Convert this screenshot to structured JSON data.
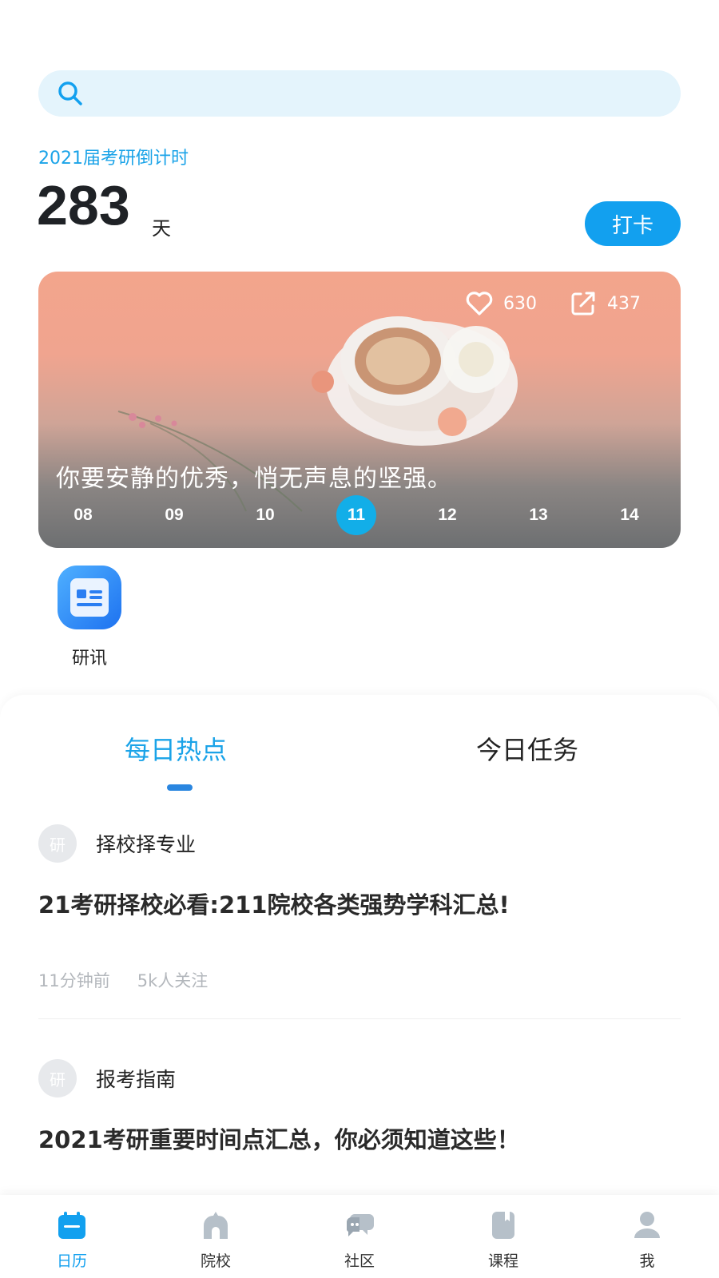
{
  "search": {
    "placeholder": ""
  },
  "countdown": {
    "label": "2021届考研倒计时",
    "days": "283",
    "unit": "天"
  },
  "checkin": {
    "label": "打卡"
  },
  "banner": {
    "likes": "630",
    "shares": "437",
    "quote": "你要安静的优秀，悄无声息的坚强。",
    "dates": [
      "08",
      "09",
      "10",
      "11",
      "12",
      "13",
      "14"
    ],
    "active_date": "11"
  },
  "quick_items": [
    {
      "label": "研讯",
      "icon": "news-icon"
    }
  ],
  "tabs": [
    {
      "label": "每日热点",
      "active": true
    },
    {
      "label": "今日任务",
      "active": false
    }
  ],
  "articles": [
    {
      "avatar": "研",
      "category": "择校择专业",
      "title": "21考研择校必看:211院校各类强势学科汇总!",
      "time": "11分钟前",
      "followers": "5k人关注"
    },
    {
      "avatar": "研",
      "category": "报考指南",
      "title": "2021考研重要时间点汇总，你必须知道这些！"
    }
  ],
  "tabbar": [
    {
      "label": "日历",
      "icon": "calendar-icon",
      "active": true
    },
    {
      "label": "院校",
      "icon": "school-icon",
      "active": false
    },
    {
      "label": "社区",
      "icon": "community-icon",
      "active": false
    },
    {
      "label": "课程",
      "icon": "course-icon",
      "active": false
    },
    {
      "label": "我",
      "icon": "user-icon",
      "active": false
    }
  ],
  "colors": {
    "accent": "#12a0ef",
    "search_bg": "#e4f4fc",
    "inactive_icon": "#b6c0c9"
  }
}
